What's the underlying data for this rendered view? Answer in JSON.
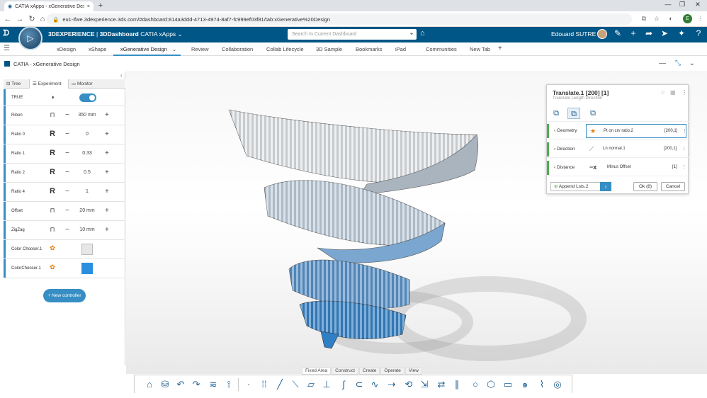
{
  "browser": {
    "tab_title": "CATIA xApps - xGenerative Desig",
    "tab_close": "×",
    "new_tab": "+",
    "url": "eu1-ifwe.3dexperience.3ds.com/#dashboard:814a3ddd-4713-4974-8af7-fc999ef03f81/tab:xGenerative%20Design",
    "profile_initial": "E"
  },
  "platform": {
    "brand": "3DEXPERIENCE",
    "dashboard": "3DDashboard",
    "app": "CATIA xApps",
    "search_placeholder": "Search In Current Dashboard",
    "user": "Edouard SUTRE"
  },
  "dashboard_tabs": [
    "xDesign",
    "xShape",
    "xGenerative Design",
    "Review",
    "Collaboration",
    "Collab Lifecycle",
    "3D Sample",
    "Bookmarks",
    "iPad",
    "Communities",
    "New Tab"
  ],
  "app_title": "CATIA - xGenerative Design",
  "panel": {
    "tabs": [
      "Tree",
      "Experiment",
      "Monitor"
    ],
    "rows": [
      {
        "label": "TRUE",
        "kind": "toggle"
      },
      {
        "label": "Ribon",
        "kind": "stepper",
        "value": "350 mm"
      },
      {
        "label": "Ratio 0",
        "kind": "stepper",
        "value": "0"
      },
      {
        "label": "Ratio 1",
        "kind": "stepper",
        "value": "0.33"
      },
      {
        "label": "Ratio 2",
        "kind": "stepper",
        "value": "0.5"
      },
      {
        "label": "Ratio 4",
        "kind": "stepper",
        "value": "1"
      },
      {
        "label": "Offset",
        "kind": "stepper",
        "value": "20 mm"
      },
      {
        "label": "ZigZag",
        "kind": "stepper",
        "value": "10 mm"
      },
      {
        "label": "Color Chooser.1",
        "kind": "color",
        "color": "#e6e6e6"
      },
      {
        "label": "ColorChooser.1",
        "kind": "color",
        "color": "#2b8fe0"
      }
    ],
    "new_controller": "New controller"
  },
  "dialog": {
    "title": "Translate.1 [200] [1]",
    "subtitle": "Translate Length Direction",
    "rows": [
      {
        "name": "Geometry",
        "text": "Pt on crv ratio.2",
        "value": "[200,1]"
      },
      {
        "name": "Direction",
        "text": "Ln normal.1",
        "value": "[200,1]"
      },
      {
        "name": "Distance",
        "text": "Minus Offset",
        "value": "[1]"
      }
    ],
    "append": "Append Lsts.2",
    "ok": "Ok (8)",
    "cancel": "Cancel"
  },
  "action_tabs": [
    "Fixed Area",
    "Construct",
    "Create",
    "Operate",
    "View"
  ],
  "colors": {
    "brand": "#005686",
    "accent": "#368ec4",
    "ribbon_light": "#d9dde2",
    "ribbon_blue": "#3b86c8",
    "status_green": "#4caf50"
  }
}
